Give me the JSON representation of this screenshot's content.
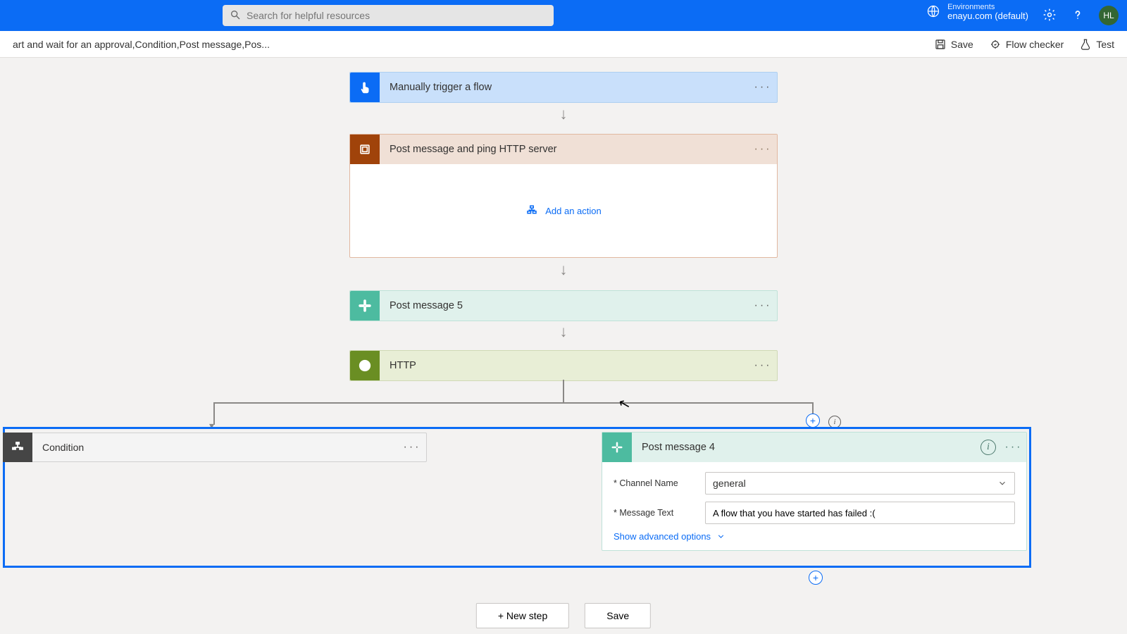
{
  "header": {
    "search_placeholder": "Search for helpful resources",
    "env_label": "Environments",
    "env_name": "enayu.com (default)",
    "avatar_initials": "HL"
  },
  "subheader": {
    "breadcrumb": "art and wait for an approval,Condition,Post message,Pos...",
    "save": "Save",
    "flow_checker": "Flow checker",
    "test": "Test"
  },
  "steps": {
    "trigger": "Manually trigger a flow",
    "scope_title": "Post message and ping HTTP server",
    "add_action": "Add an action",
    "post5": "Post message 5",
    "http": "HTTP"
  },
  "parallel": {
    "condition_title": "Condition",
    "pm4_title": "Post message 4",
    "channel_label": "Channel Name",
    "channel_value": "general",
    "message_label": "Message Text",
    "message_value": "A flow that you have started has failed :(",
    "adv_options": "Show advanced options"
  },
  "bottom": {
    "new_step": "+ New step",
    "save": "Save"
  }
}
